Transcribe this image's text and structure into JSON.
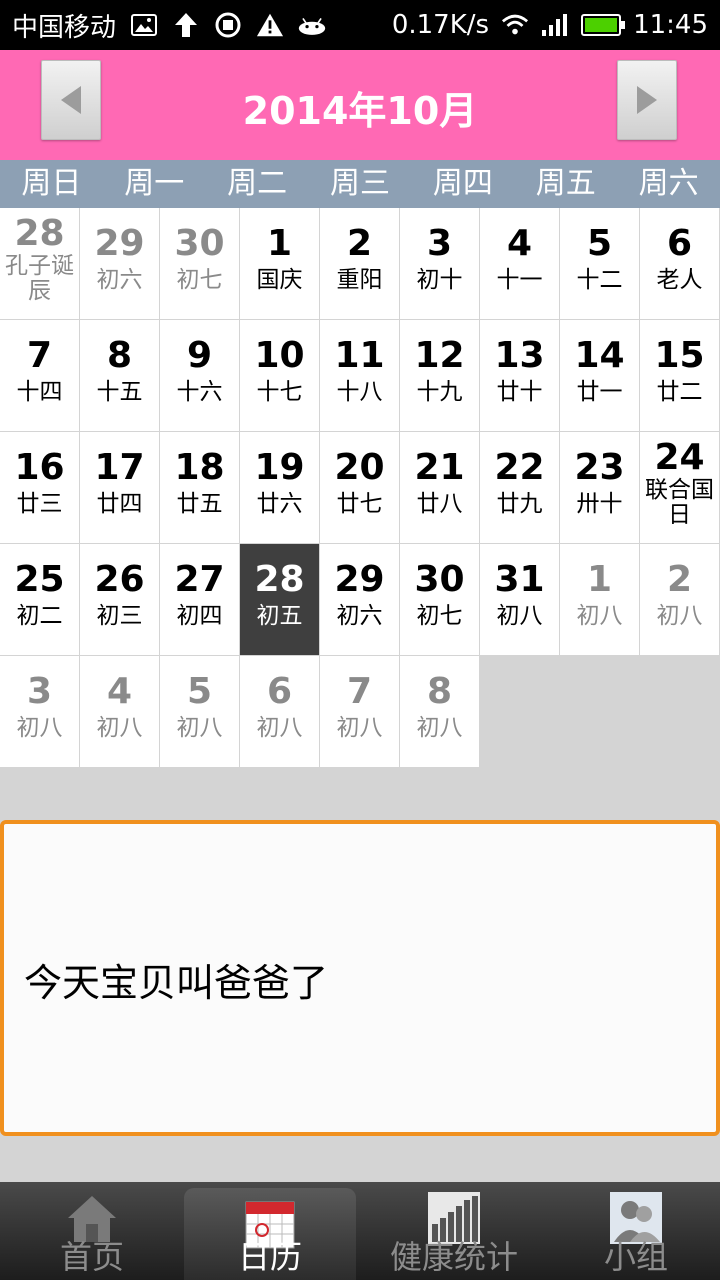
{
  "status_bar": {
    "carrier": "中国移动",
    "speed": "0.17K/s",
    "time": "11:45",
    "icons": [
      "image-icon",
      "upload-arrow-icon",
      "sync-icon",
      "warning-icon",
      "android-icon",
      "wifi-icon",
      "signal-icon",
      "battery-icon"
    ],
    "battery_level": 1.0
  },
  "header": {
    "title": "2014年10月",
    "bg_color": "#ff69b4"
  },
  "weekdays": [
    "周日",
    "周一",
    "周二",
    "周三",
    "周四",
    "周五",
    "周六"
  ],
  "calendar": {
    "weeks": [
      [
        {
          "day": "28",
          "lunar": "孔子诞辰",
          "other": true,
          "tight": true
        },
        {
          "day": "29",
          "lunar": "初六",
          "other": true
        },
        {
          "day": "30",
          "lunar": "初七",
          "other": true
        },
        {
          "day": "1",
          "lunar": "国庆"
        },
        {
          "day": "2",
          "lunar": "重阳"
        },
        {
          "day": "3",
          "lunar": "初十"
        },
        {
          "day": "4",
          "lunar": "十一"
        },
        {
          "day": "5",
          "lunar": "十二"
        },
        {
          "day": "6",
          "lunar": "老人"
        }
      ],
      [
        {
          "day": "7",
          "lunar": "十四"
        },
        {
          "day": "8",
          "lunar": "十五"
        },
        {
          "day": "9",
          "lunar": "十六"
        },
        {
          "day": "10",
          "lunar": "十七"
        },
        {
          "day": "11",
          "lunar": "十八"
        },
        {
          "day": "12",
          "lunar": "十九"
        },
        {
          "day": "13",
          "lunar": "廿十"
        },
        {
          "day": "14",
          "lunar": "廿一"
        },
        {
          "day": "15",
          "lunar": "廿二"
        }
      ],
      [
        {
          "day": "16",
          "lunar": "廿三"
        },
        {
          "day": "17",
          "lunar": "廿四"
        },
        {
          "day": "18",
          "lunar": "廿五"
        },
        {
          "day": "19",
          "lunar": "廿六"
        },
        {
          "day": "20",
          "lunar": "廿七"
        },
        {
          "day": "21",
          "lunar": "廿八"
        },
        {
          "day": "22",
          "lunar": "廿九"
        },
        {
          "day": "23",
          "lunar": "卅十"
        },
        {
          "day": "24",
          "lunar": "联合国日",
          "tight": true
        }
      ],
      [
        {
          "day": "25",
          "lunar": "初二"
        },
        {
          "day": "26",
          "lunar": "初三"
        },
        {
          "day": "27",
          "lunar": "初四"
        },
        {
          "day": "28",
          "lunar": "初五",
          "today": true
        },
        {
          "day": "29",
          "lunar": "初六"
        },
        {
          "day": "30",
          "lunar": "初七"
        },
        {
          "day": "31",
          "lunar": "初八"
        },
        {
          "day": "1",
          "lunar": "初八",
          "other": true
        },
        {
          "day": "2",
          "lunar": "初八",
          "other": true
        }
      ],
      [
        {
          "day": "3",
          "lunar": "初八",
          "other": true
        },
        {
          "day": "4",
          "lunar": "初八",
          "other": true
        },
        {
          "day": "5",
          "lunar": "初八",
          "other": true
        },
        {
          "day": "6",
          "lunar": "初八",
          "other": true
        },
        {
          "day": "7",
          "lunar": "初八",
          "other": true
        },
        {
          "day": "8",
          "lunar": "初八",
          "other": true
        }
      ]
    ]
  },
  "note": {
    "text": "今天宝贝叫爸爸了",
    "border_color": "#f0901e"
  },
  "tabs": [
    {
      "label": "首页",
      "icon": "home-icon"
    },
    {
      "label": "日历",
      "icon": "calendar-icon",
      "active": true
    },
    {
      "label": "健康统计",
      "icon": "bar-stats-icon"
    },
    {
      "label": "小组",
      "icon": "group-icon"
    }
  ]
}
